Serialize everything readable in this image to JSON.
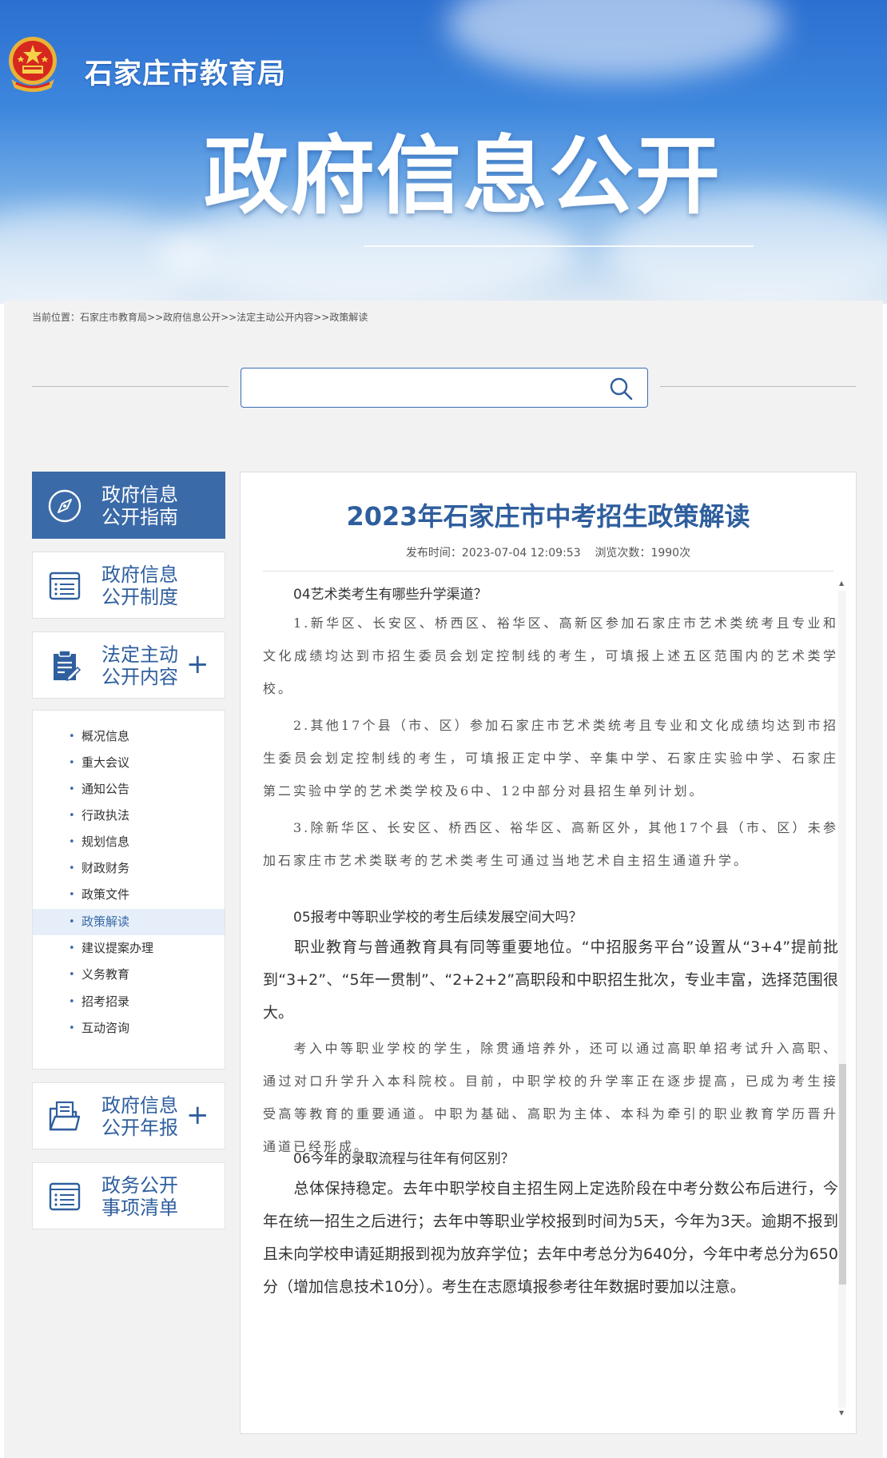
{
  "header": {
    "site_name": "石家庄市教育局",
    "banner_title": "政府信息公开"
  },
  "breadcrumb": {
    "label": "当前位置：",
    "path": "石家庄市教育局>>政府信息公开>>法定主动公开内容>>政策解读"
  },
  "search": {
    "placeholder": "",
    "icon": "search-icon"
  },
  "sidebar": {
    "guide": {
      "line1": "政府信息",
      "line2": "公开指南",
      "icon": "compass-icon"
    },
    "system": {
      "line1": "政府信息",
      "line2": "公开制度",
      "icon": "list-doc-icon"
    },
    "statutory": {
      "line1": "法定主动",
      "line2": "公开内容",
      "icon": "clipboard-edit-icon",
      "expand": "+"
    },
    "subnav": [
      "概况信息",
      "重大会议",
      "通知公告",
      "行政执法",
      "规划信息",
      "财政财务",
      "政策文件",
      "政策解读",
      "建议提案办理",
      "义务教育",
      "招考招录",
      "互动咨询"
    ],
    "subnav_selected": "政策解读",
    "annual": {
      "line1": "政府信息",
      "line2": "公开年报",
      "icon": "folder-doc-icon",
      "expand": "+"
    },
    "matters": {
      "line1": "政务公开",
      "line2": "事项清单",
      "icon": "list-doc-icon"
    }
  },
  "article": {
    "title": "2023年石家庄市中考招生政策解读",
    "publish_label": "发布时间：",
    "publish_time": "2023-07-04 12:09:53",
    "views_label": "浏览次数：",
    "views": "1990次",
    "q4": "04艺术类考生有哪些升学渠道？",
    "p4_1": "1.新华区、长安区、桥西区、裕华区、高新区参加石家庄市艺术类统考且专业和文化成绩均达到市招生委员会划定控制线的考生，可填报上述五区范围内的艺术类学校。",
    "p4_2": "2.其他17个县（市、区）参加石家庄市艺术类统考且专业和文化成绩均达到市招生委员会划定控制线的考生，可填报正定中学、辛集中学、石家庄实验中学、石家庄第二实验中学的艺术类学校及6中、12中部分对县招生单列计划。",
    "p4_3": "3.除新华区、长安区、桥西区、裕华区、高新区外，其他17个县（市、区）未参加石家庄市艺术类联考的艺术类考生可通过当地艺术自主招生通道升学。",
    "q5": "05报考中等职业学校的考生后续发展空间大吗？",
    "p5_1": "职业教育与普通教育具有同等重要地位。“中招服务平台”设置从“3+4”提前批到“3+2”、“5年一贯制”、“2+2+2”高职段和中职招生批次，专业丰富，选择范围很大。",
    "p5_2": "考入中等职业学校的学生，除贯通培养外，还可以通过高职单招考试升入高职、通过对口升学升入本科院校。目前，中职学校的升学率正在逐步提高，已成为考生接受高等教育的重要通道。中职为基础、高职为主体、本科为牵引的职业教育学历晋升通道已经形成。",
    "q6": "06今年的录取流程与往年有何区别？",
    "p6_1": "总体保持稳定。去年中职学校自主招生网上定选阶段在中考分数公布后进行，今年在统一招生之后进行；去年中等职业学校报到时间为5天，今年为3天。逾期不报到且未向学校申请延期报到视为放弃学位；去年中考总分为640分，今年中考总分为650分（增加信息技术10分）。考生在志愿填报参考往年数据时要加以注意。"
  },
  "colors": {
    "accent": "#2e5e9d",
    "sidebar_active": "#3b6aa8"
  }
}
